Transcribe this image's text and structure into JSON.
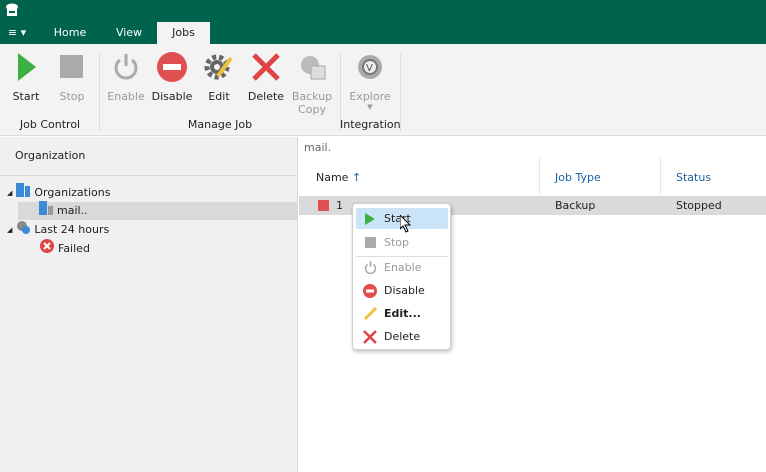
{
  "titlebar": {
    "menu_label": "≡ ▾",
    "tabs": [
      "Home",
      "View",
      "Jobs"
    ],
    "active_tab": "Jobs"
  },
  "ribbon": {
    "buttons": [
      {
        "label": "Start",
        "enabled": true
      },
      {
        "label": "Stop",
        "enabled": false
      },
      {
        "label": "Enable",
        "enabled": false
      },
      {
        "label": "Disable",
        "enabled": true
      },
      {
        "label": "Edit",
        "enabled": true
      },
      {
        "label": "Delete",
        "enabled": true
      },
      {
        "label": "Backup Copy",
        "enabled": false
      },
      {
        "label": "Explore",
        "enabled": false
      }
    ],
    "groups": [
      "Job Control",
      "Manage Job",
      "Integration"
    ]
  },
  "left": {
    "header": "Organization",
    "tree": [
      {
        "label": "Organizations"
      },
      {
        "label": "mail.."
      },
      {
        "label": "Last 24 hours"
      },
      {
        "label": "Failed"
      }
    ]
  },
  "right": {
    "path": "mail.",
    "columns": [
      "Name",
      "Job Type",
      "Status"
    ],
    "sort_icon": "↑",
    "rows": [
      {
        "name": "1",
        "type": "Backup",
        "status": "Stopped"
      }
    ]
  },
  "context_menu": [
    {
      "label": "Start",
      "enabled": true
    },
    {
      "label": "Stop",
      "enabled": false
    },
    {
      "label": "Enable",
      "enabled": false
    },
    {
      "label": "Disable",
      "enabled": true
    },
    {
      "label": "Edit...",
      "enabled": true
    },
    {
      "label": "Delete",
      "enabled": true
    }
  ],
  "colors": {
    "brand": "#00634b",
    "start": "#3cb043",
    "danger": "#e05050",
    "accent": "#1a5f9e"
  }
}
